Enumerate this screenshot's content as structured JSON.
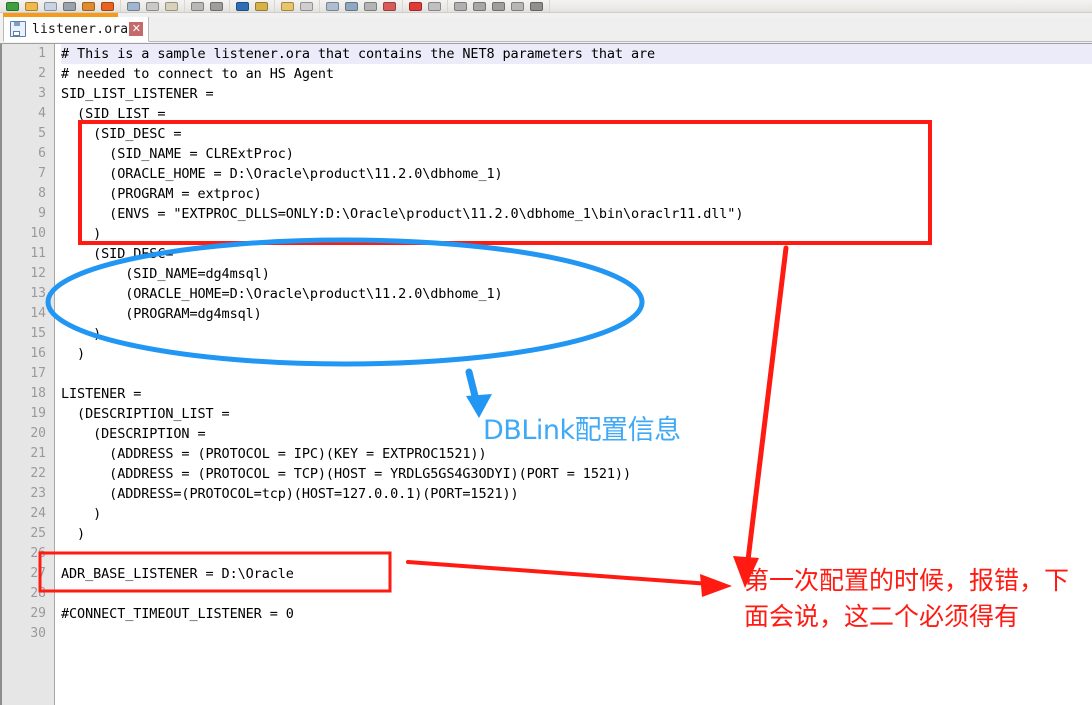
{
  "window": {
    "title": "listener.ora"
  },
  "toolbar": {
    "icons": [
      {
        "name": "new-icon",
        "color": "#3f9e3f"
      },
      {
        "name": "open-folder-icon",
        "color": "#f0b94a"
      },
      {
        "name": "save-icon",
        "color": "#c8d4e2"
      },
      {
        "name": "save-all-icon",
        "color": "#9aa3ac"
      },
      {
        "name": "print-icon",
        "color": "#e08a2e"
      },
      {
        "name": "print-preview-icon",
        "color": "#e8631f"
      },
      {
        "name": "cut-icon",
        "color": "#9fb6cc"
      },
      {
        "name": "copy-icon",
        "color": "#c9c9c9"
      },
      {
        "name": "paste-icon",
        "color": "#d8d2bb"
      },
      {
        "name": "undo-icon",
        "color": "#b8b8b8"
      },
      {
        "name": "redo-icon",
        "color": "#9d9d9d"
      },
      {
        "name": "find-icon",
        "color": "#2d6fb7"
      },
      {
        "name": "replace-icon",
        "color": "#d7b14a"
      },
      {
        "name": "zoom-in-icon",
        "color": "#e8c46a"
      },
      {
        "name": "zoom-out-icon",
        "color": "#cfcfcf"
      },
      {
        "name": "word-wrap-icon",
        "color": "#aebdd0"
      },
      {
        "name": "show-all-chars-icon",
        "color": "#8fa8c0"
      },
      {
        "name": "indent-guide-icon",
        "color": "#b4b4b4"
      },
      {
        "name": "bookmark-icon",
        "color": "#d95a5a"
      },
      {
        "name": "record-macro-icon",
        "color": "#e03a3a"
      },
      {
        "name": "play-macro-icon",
        "color": "#c0c0c0"
      },
      {
        "name": "settings-icon",
        "color": "#b0b0b0"
      },
      {
        "name": "sync-scroll-icon",
        "color": "#a7a7a7"
      },
      {
        "name": "document-map-icon",
        "color": "#9e9e9e"
      },
      {
        "name": "function-list-icon",
        "color": "#b6b6b6"
      },
      {
        "name": "folder-as-workspace-icon",
        "color": "#8f8f8f"
      }
    ]
  },
  "tab": {
    "label": "listener.ora",
    "close_label": "✕",
    "accent_color": "#f59b1c"
  },
  "editor": {
    "highlighted_line": 1,
    "lines": [
      {
        "n": "1",
        "text": "# This is a sample listener.ora that contains the NET8 parameters that are"
      },
      {
        "n": "2",
        "text": "# needed to connect to an HS Agent"
      },
      {
        "n": "3",
        "text": "SID_LIST_LISTENER ="
      },
      {
        "n": "4",
        "text": "  (SID_LIST ="
      },
      {
        "n": "5",
        "text": "    (SID_DESC ="
      },
      {
        "n": "6",
        "text": "      (SID_NAME = CLRExtProc)"
      },
      {
        "n": "7",
        "text": "      (ORACLE_HOME = D:\\Oracle\\product\\11.2.0\\dbhome_1)"
      },
      {
        "n": "8",
        "text": "      (PROGRAM = extproc)"
      },
      {
        "n": "9",
        "text": "      (ENVS = \"EXTPROC_DLLS=ONLY:D:\\Oracle\\product\\11.2.0\\dbhome_1\\bin\\oraclr11.dll\")"
      },
      {
        "n": "10",
        "text": "    )"
      },
      {
        "n": "11",
        "text": "    (SID_DESC="
      },
      {
        "n": "12",
        "text": "        (SID_NAME=dg4msql)"
      },
      {
        "n": "13",
        "text": "        (ORACLE_HOME=D:\\Oracle\\product\\11.2.0\\dbhome_1)"
      },
      {
        "n": "14",
        "text": "        (PROGRAM=dg4msql)"
      },
      {
        "n": "15",
        "text": "    )"
      },
      {
        "n": "16",
        "text": "  )"
      },
      {
        "n": "17",
        "text": ""
      },
      {
        "n": "18",
        "text": "LISTENER ="
      },
      {
        "n": "19",
        "text": "  (DESCRIPTION_LIST ="
      },
      {
        "n": "20",
        "text": "    (DESCRIPTION ="
      },
      {
        "n": "21",
        "text": "      (ADDRESS = (PROTOCOL = IPC)(KEY = EXTPROC1521))"
      },
      {
        "n": "22",
        "text": "      (ADDRESS = (PROTOCOL = TCP)(HOST = YRDLG5GS4G3ODYI)(PORT = 1521))"
      },
      {
        "n": "23",
        "text": "      (ADDRESS=(PROTOCOL=tcp)(HOST=127.0.0.1)(PORT=1521))"
      },
      {
        "n": "24",
        "text": "    )"
      },
      {
        "n": "25",
        "text": "  )"
      },
      {
        "n": "26",
        "text": ""
      },
      {
        "n": "27",
        "text": "ADR_BASE_LISTENER = D:\\Oracle"
      },
      {
        "n": "28",
        "text": ""
      },
      {
        "n": "29",
        "text": "#CONNECT_TIMEOUT_LISTENER = 0"
      },
      {
        "n": "30",
        "text": ""
      }
    ]
  },
  "annotations": {
    "dblink_label": "DBLink配置信息",
    "note_label": "第一次配置的时候，报错，下面会说，这二个必须得有",
    "red_color": "#ff1a12",
    "blue_color": "#3fa9f5"
  }
}
